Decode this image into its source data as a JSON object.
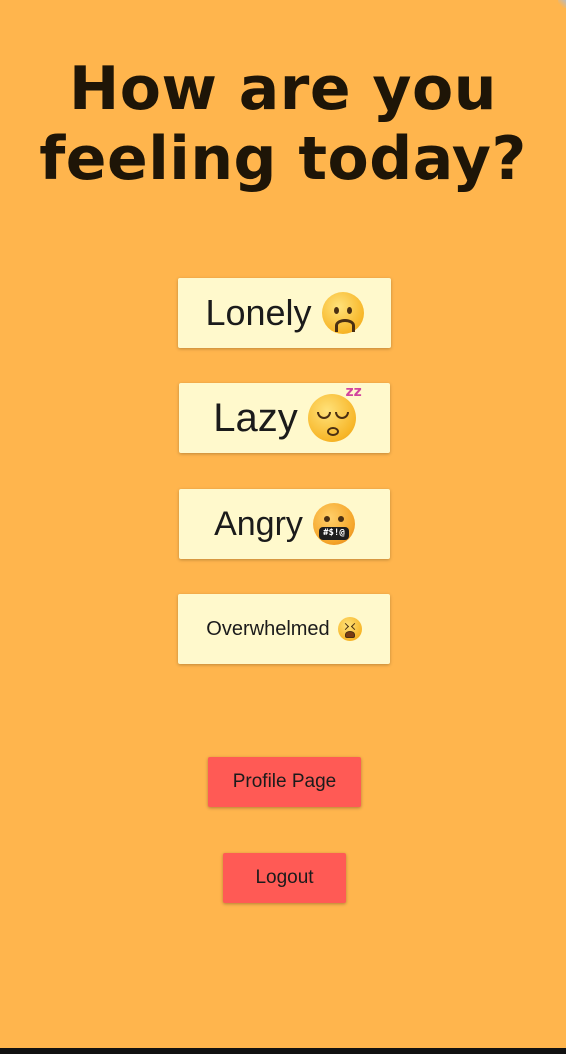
{
  "heading": {
    "line1": "How are you",
    "line2": "feeling today?"
  },
  "moods": [
    {
      "label": "Lonely",
      "emoji": "worried-face"
    },
    {
      "label": "Lazy",
      "emoji": "sleeping-face"
    },
    {
      "label": "Angry",
      "emoji": "face-with-symbols-on-mouth"
    },
    {
      "label": "Overwhelmed",
      "emoji": "tired-face"
    }
  ],
  "actions": {
    "profile_label": "Profile Page",
    "logout_label": "Logout"
  },
  "grawlix": "#$!@",
  "snore": "zz",
  "colors": {
    "background": "#FFB54D",
    "mood_button": "#FFF9CC",
    "action_button": "#FF5A55",
    "heading_text": "#1E1507"
  }
}
